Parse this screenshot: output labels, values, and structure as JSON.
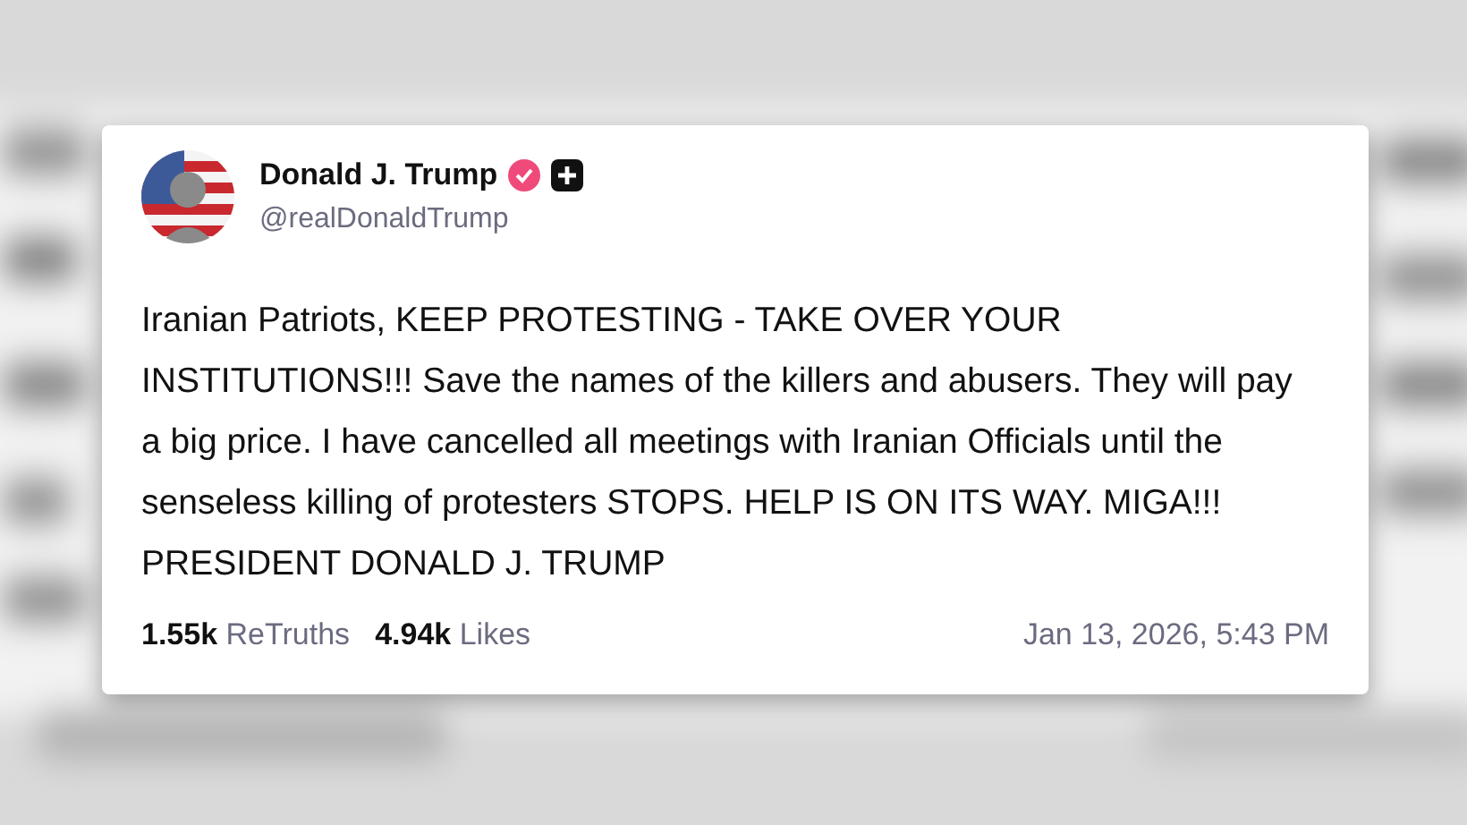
{
  "author": {
    "name": "Donald J. Trump",
    "handle": "@realDonaldTrump",
    "verified": true
  },
  "post": {
    "text": "Iranian Patriots, KEEP PROTESTING - TAKE OVER YOUR INSTITUTIONS!!! Save the names of the killers and abusers. They will pay a big price. I have cancelled all meetings with Iranian Officials until the senseless killing of protesters STOPS. HELP IS ON ITS WAY. MIGA!!! PRESIDENT DONALD J. TRUMP"
  },
  "stats": [
    {
      "count": "1.55k",
      "label": "ReTruths"
    },
    {
      "count": "4.94k",
      "label": "Likes"
    }
  ],
  "timestamp": "Jan 13, 2026, 5:43 PM"
}
